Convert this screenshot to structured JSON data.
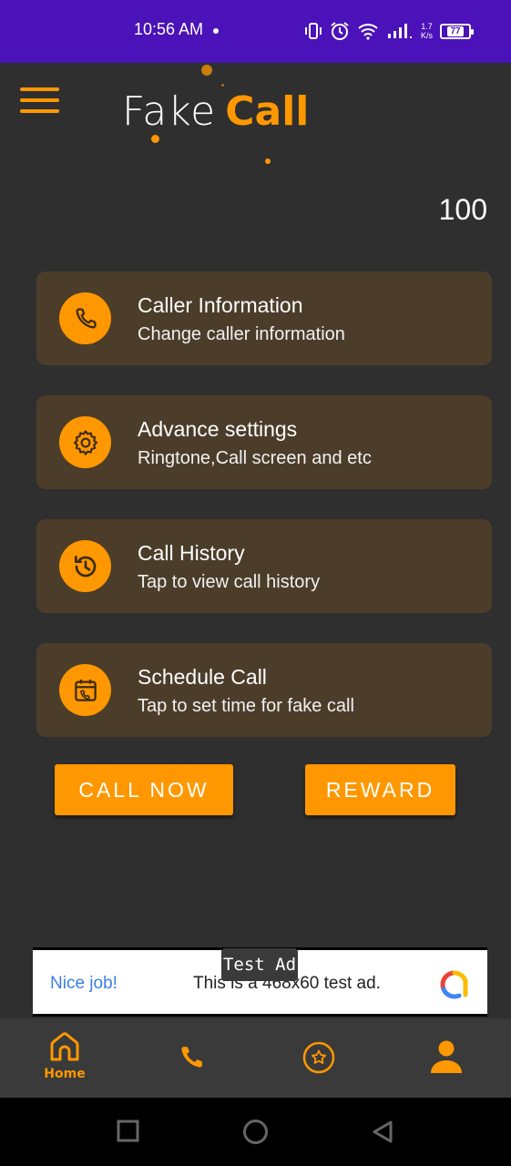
{
  "status_bar": {
    "time": "10:56 AM",
    "net_speed_top": "1.7",
    "net_speed_bottom": "K/s",
    "battery": "77",
    "background": "#4a12b8"
  },
  "header": {
    "menu_icon": "hamburger-menu-icon",
    "logo_word_1": "Fake",
    "logo_word_2": "Call",
    "accent": "#ff9800"
  },
  "counter": "100",
  "menu_cards": [
    {
      "title": "Caller Information",
      "subtitle": "Change caller information",
      "icon": "phone-icon"
    },
    {
      "title": "Advance settings",
      "subtitle": "Ringtone,Call screen and etc",
      "icon": "gear-icon"
    },
    {
      "title": "Call History",
      "subtitle": "Tap to view call history",
      "icon": "history-icon"
    },
    {
      "title": "Schedule Call",
      "subtitle": "Tap to set time for fake call",
      "icon": "calendar-phone-icon"
    }
  ],
  "buttons": {
    "call_now": "CALL NOW",
    "reward": "REWARD"
  },
  "ad": {
    "label": "Test Ad",
    "headline": "Nice job!",
    "body": "This is a 468x60 test ad."
  },
  "bottom_nav": {
    "items": [
      {
        "label": "Home",
        "icon": "home-icon",
        "active": true
      },
      {
        "label": "",
        "icon": "phone-icon"
      },
      {
        "label": "",
        "icon": "star-badge-icon"
      },
      {
        "label": "",
        "icon": "user-icon"
      }
    ]
  },
  "system_nav": [
    "recents-square-icon",
    "home-circle-icon",
    "back-triangle-icon"
  ]
}
